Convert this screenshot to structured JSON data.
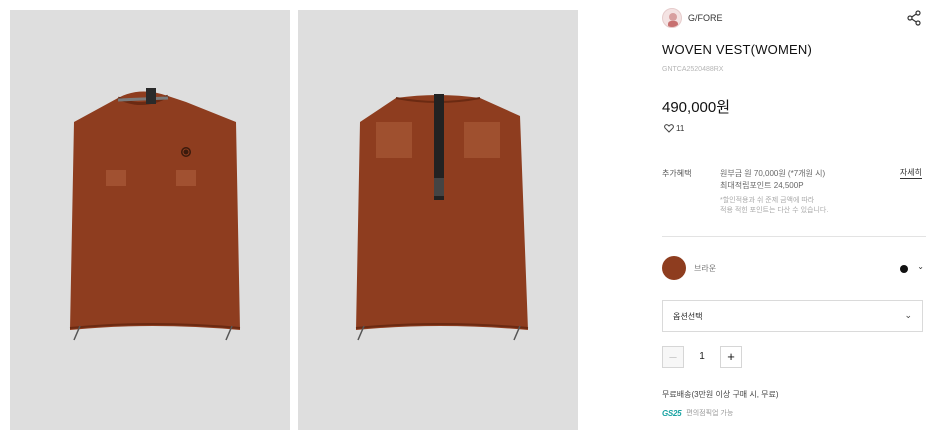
{
  "product": {
    "brand": "G/FORE",
    "title": "WOVEN VEST(WOMEN)",
    "code": "GNTCA2520488RX",
    "price": "490,000원",
    "likes": "11",
    "benefit": {
      "label": "추가혜택",
      "line1": "원부금 원 70,000원 (*7개원 시)",
      "line2": "최대적립포인트 24,500P",
      "note1": "*할인적용과 쉬 준제 금액에 따라",
      "note2": "적용 적힌 포인트는 다산 수 있습니다.",
      "detail_link": "자세히"
    },
    "color": {
      "name": "브라운",
      "swatch": "#8e3d1f"
    },
    "option_select": "옵션선택",
    "quantity": "1",
    "shipping": "무료배송(3만원 이상 구매 시, 무료)",
    "gs_logo": "GS25",
    "gs_text": "편의점픽업 가능"
  },
  "images": [
    {
      "view": "front",
      "garment_color": "#8e3d1f"
    },
    {
      "view": "back",
      "garment_color": "#8e3d1f"
    }
  ],
  "icons": {
    "share": "share-icon",
    "heart": "heart-icon",
    "chevron": "chevron-down-icon"
  }
}
